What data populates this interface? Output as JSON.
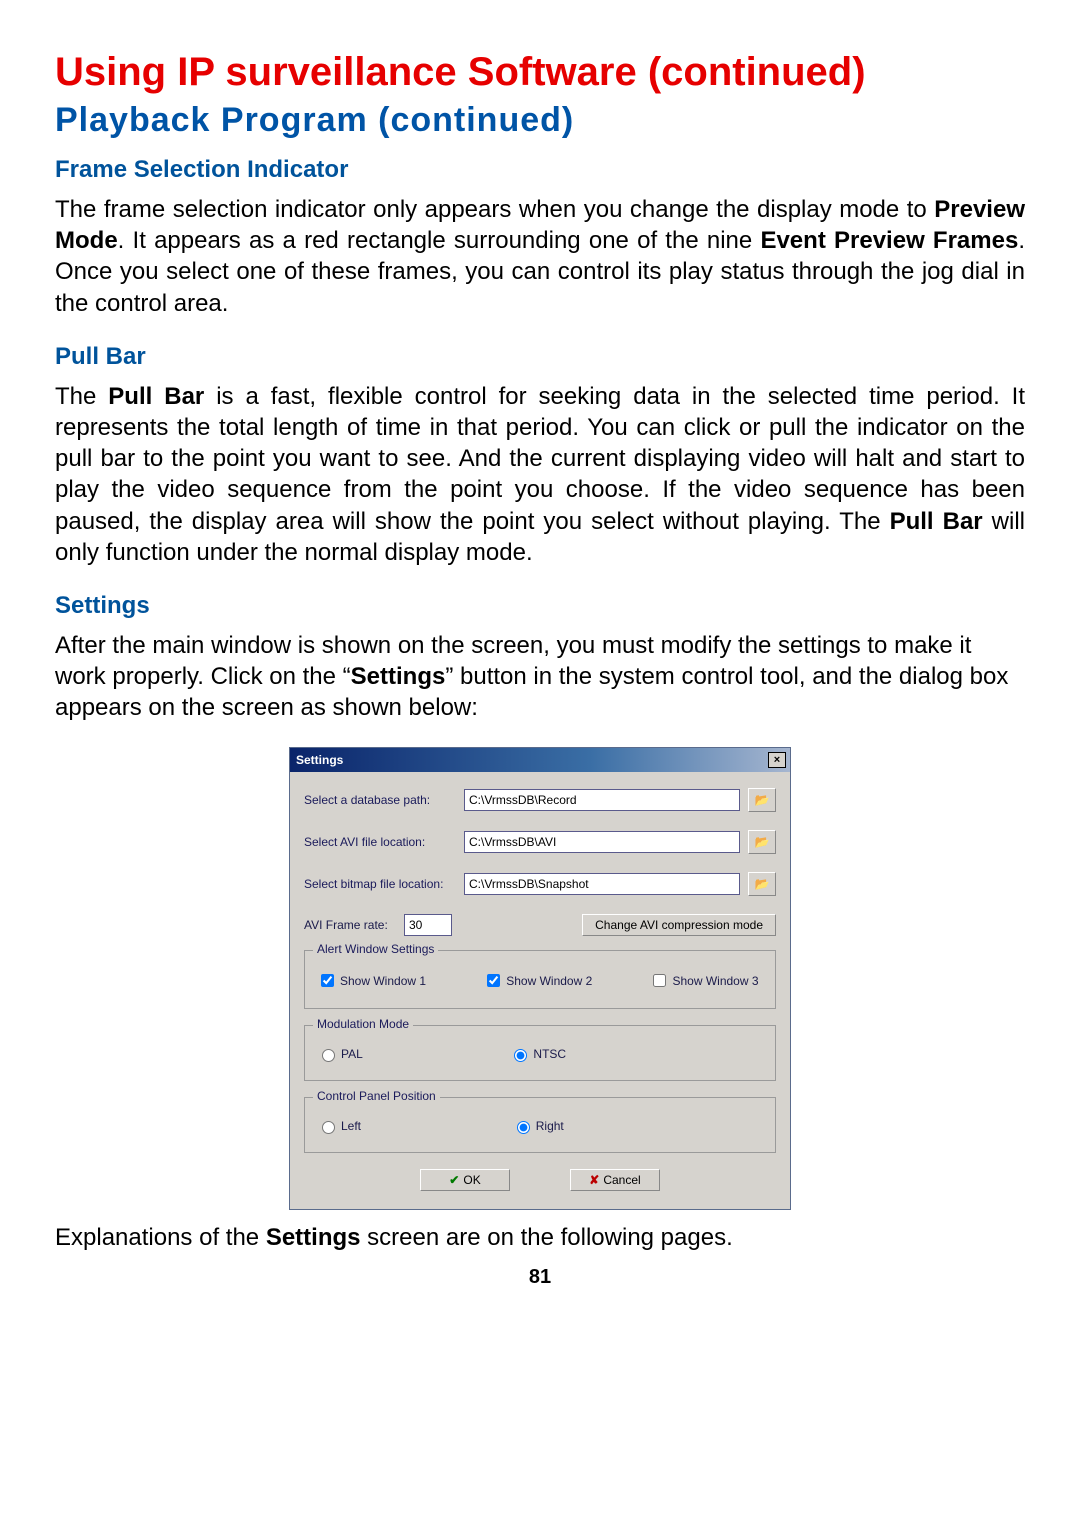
{
  "title_main": "Using IP surveillance Software (continued)",
  "title_sub": "Playback  Program  (continued)",
  "sections": {
    "frame_indicator": {
      "heading": "Frame Selection Indicator"
    },
    "pull_bar": {
      "heading": "Pull Bar"
    },
    "settings": {
      "heading": "Settings"
    }
  },
  "dialog": {
    "title": "Settings",
    "db_path_label": "Select a database path:",
    "db_path_value": "C:\\VrmssDB\\Record",
    "avi_loc_label": "Select AVI file location:",
    "avi_loc_value": "C:\\VrmssDB\\AVI",
    "bmp_loc_label": "Select bitmap file location:",
    "bmp_loc_value": "C:\\VrmssDB\\Snapshot",
    "frame_rate_label": "AVI Frame rate:",
    "frame_rate_value": "30",
    "change_avi_btn": "Change AVI compression mode",
    "alert_group": "Alert Window Settings",
    "show_w1": "Show Window 1",
    "show_w2": "Show Window 2",
    "show_w3": "Show Window 3",
    "mod_group": "Modulation Mode",
    "pal": "PAL",
    "ntsc": "NTSC",
    "cpp_group": "Control Panel Position",
    "left": "Left",
    "right": "Right",
    "ok": "OK",
    "cancel": "Cancel"
  },
  "page_number": "81"
}
